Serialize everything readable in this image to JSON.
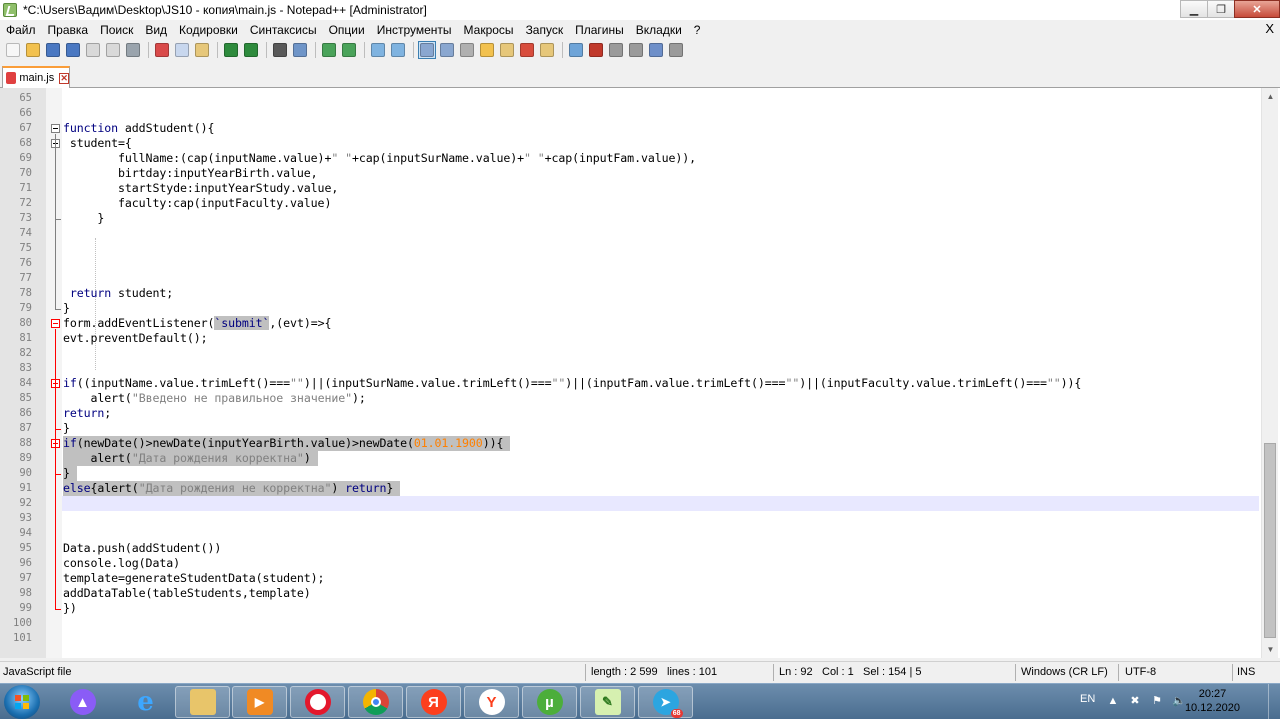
{
  "window": {
    "title": "*C:\\Users\\Вадим\\Desktop\\JS10 - копия\\main.js - Notepad++ [Administrator]",
    "minimize": "▁",
    "restore": "❐",
    "close": "✕"
  },
  "menu": {
    "items": [
      "Файл",
      "Правка",
      "Поиск",
      "Вид",
      "Кодировки",
      "Синтаксисы",
      "Опции",
      "Инструменты",
      "Макросы",
      "Запуск",
      "Плагины",
      "Вкладки",
      "?"
    ],
    "close": "X"
  },
  "toolbar": {
    "icons": [
      "new-file",
      "open-file",
      "save",
      "save-all",
      "close",
      "close-all",
      "print",
      "cut",
      "copy",
      "paste",
      "undo",
      "redo",
      "find",
      "replace",
      "zoom-in",
      "zoom-out",
      "sync-v",
      "sync-h",
      "word-wrap",
      "show-all-chars",
      "indent-guide",
      "udl",
      "doc-map",
      "function-list",
      "folder-workspace",
      "monitoring",
      "record-macro",
      "stop-macro",
      "play-macro",
      "run-macro-multiple",
      "save-macro"
    ],
    "colors": [
      "#f7f7f7",
      "#f2c14e",
      "#4a78c2",
      "#4a78c2",
      "#d9d9d9",
      "#d9d9d9",
      "#9aa4ad",
      "#d94a4a",
      "#c8d7ee",
      "#e6c77a",
      "#2e8b3d",
      "#2e8b3d",
      "#5a5a5a",
      "#6f95c8",
      "#4aa35a",
      "#4aa35a",
      "#7fb3e0",
      "#7fb3e0",
      "#8aa7d0",
      "#8aa7d0",
      "#b0b0b0",
      "#f2c14e",
      "#e6c77a",
      "#d84d3d",
      "#e6c77a",
      "#6ea4d8",
      "#c0392b",
      "#9a9a9a",
      "#9a9a9a",
      "#6e8fc9",
      "#9a9a9a"
    ]
  },
  "tab": {
    "label": "main.js",
    "close": "✕"
  },
  "editor": {
    "line_numbers": [
      "65",
      "66",
      "67",
      "68",
      "69",
      "70",
      "71",
      "72",
      "73",
      "74",
      "75",
      "76",
      "77",
      "78",
      "79",
      "80",
      "81",
      "82",
      "83",
      "84",
      "85",
      "86",
      "87",
      "88",
      "89",
      "90",
      "91",
      "92",
      "93",
      "94",
      "95",
      "96",
      "97",
      "98",
      "99",
      "100",
      "101"
    ],
    "lines": [
      "",
      "",
      "function addStudent(){",
      " student={",
      "        fullName:(cap(inputName.value)+\" \"+cap(inputSurName.value)+\" \"+cap(inputFam.value)),",
      "        birtday:inputYearBirth.value,",
      "        startStyde:inputYearStudy.value,",
      "        faculty:cap(inputFaculty.value)",
      "     }",
      "",
      "",
      "",
      "",
      " return student;",
      "}",
      "form.addEventListener(`submit`,(evt)=>{",
      "evt.preventDefault();",
      "",
      "",
      "if((inputName.value.trimLeft()===\"\")||(inputSurName.value.trimLeft()===\"\")||(inputFam.value.trimLeft()===\"\")||(inputFaculty.value.trimLeft()===\"\")){",
      "    alert(\"Введено не правильное значение\");",
      "return;",
      "}",
      "if(newDate()>newDate(inputYearBirth.value)>newDate(01.01.1900)){",
      "    alert(\"Дата рождения корректна\")",
      "}",
      "else{alert(\"Дата рождения не корректна\") return}",
      "",
      "",
      "",
      "Data.push(addStudent())",
      "console.log(Data)",
      "template=generateStudentData(student);",
      "addDataTable(tableStudents,template)",
      "})",
      "",
      ""
    ]
  },
  "status": {
    "file_type": "JavaScript file",
    "length": "length : 2 599",
    "lines": "lines : 101",
    "ln": "Ln : 92",
    "col": "Col : 1",
    "sel": "Sel : 154 | 5",
    "eol": "Windows (CR LF)",
    "encoding": "UTF-8",
    "mode": "INS"
  },
  "taskbar": {
    "apps": [
      "alice",
      "internet-explorer",
      "file-explorer",
      "media-player",
      "opera",
      "chrome",
      "yandex",
      "yandex-browser",
      "utorrent",
      "notepad-plus-plus",
      "telegram"
    ],
    "telegram_badge": "68",
    "language": "EN",
    "time": "20:27",
    "date": "10.12.2020"
  }
}
